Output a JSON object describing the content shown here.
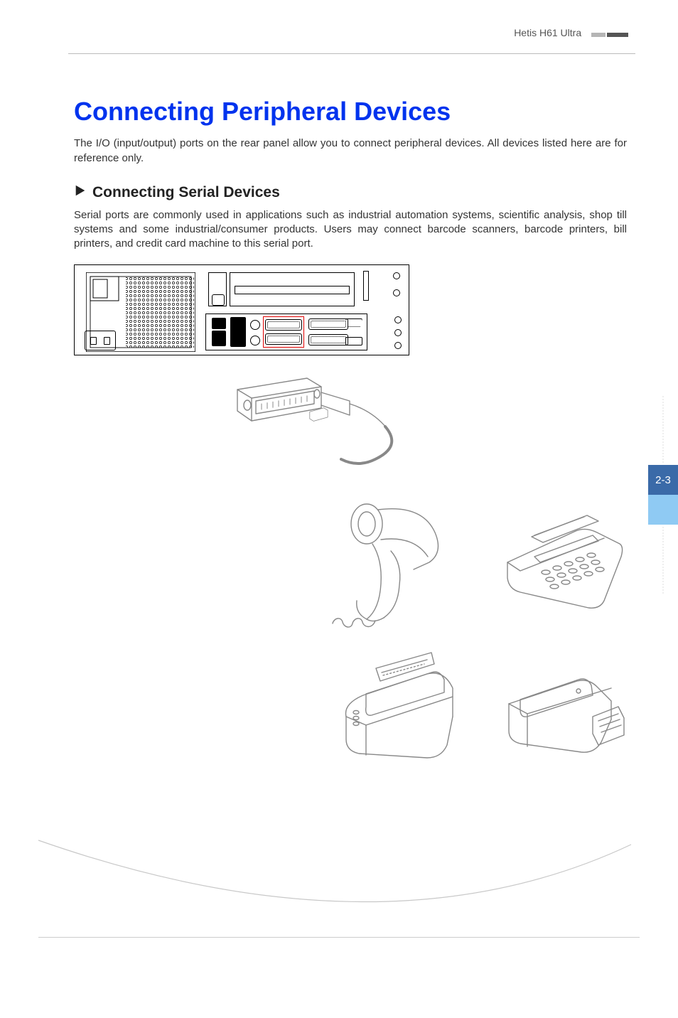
{
  "header": {
    "product": "Hetis H61 Ultra"
  },
  "page_number": "2-3",
  "heading": "Connecting Peripheral Devices",
  "intro": "The I/O (input/output) ports on the rear panel allow you to connect peripheral devices. All devices listed here are for reference only.",
  "subheading": "Connecting Serial Devices",
  "body": "Serial ports are commonly used in applications such as industrial automation systems, scientific analysis, shop till systems and some industrial/consumer products. Users may connect barcode scanners, barcode printers, bill printers, and credit card machine to this serial port.",
  "diagram_labels": {
    "rear_panel": "rear-panel",
    "highlighted_port": "serial-ports",
    "cable": "serial-cable",
    "scanner": "barcode-scanner",
    "card_machine": "credit-card-machine",
    "receipt_printer": "bill-printer",
    "label_printer": "barcode-printer"
  }
}
